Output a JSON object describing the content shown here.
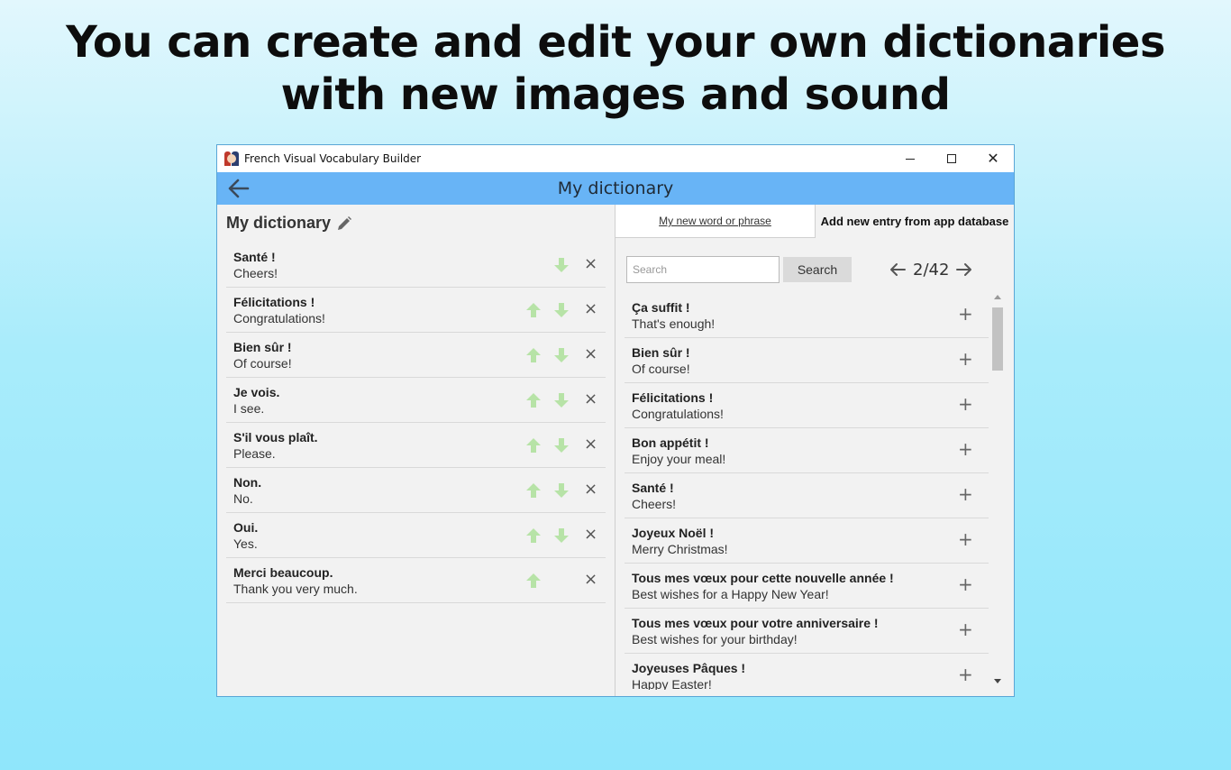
{
  "headline": {
    "line1": "You can create and edit your own dictionaries",
    "line2": "with new images and sound"
  },
  "window": {
    "title": "French Visual Vocabulary Builder",
    "header_title": "My dictionary"
  },
  "my_dictionary": {
    "heading": "My dictionary",
    "entries": [
      {
        "fr": "Santé !",
        "en": "Cheers!",
        "up": false,
        "down": true
      },
      {
        "fr": "Félicitations !",
        "en": "Congratulations!",
        "up": true,
        "down": true
      },
      {
        "fr": "Bien sûr !",
        "en": "Of course!",
        "up": true,
        "down": true
      },
      {
        "fr": "Je vois.",
        "en": "I see.",
        "up": true,
        "down": true
      },
      {
        "fr": "S'il vous plaît.",
        "en": "Please.",
        "up": true,
        "down": true
      },
      {
        "fr": "Non.",
        "en": "No.",
        "up": true,
        "down": true
      },
      {
        "fr": "Oui.",
        "en": "Yes.",
        "up": true,
        "down": true
      },
      {
        "fr": "Merci beaucoup.",
        "en": "Thank you very much.",
        "up": true,
        "down": false
      }
    ]
  },
  "tabs": {
    "new_word": "My new word or phrase",
    "add_from_db": "Add new entry from app database"
  },
  "search": {
    "placeholder": "Search",
    "button": "Search"
  },
  "pager": {
    "text": "2/42"
  },
  "database": {
    "entries": [
      {
        "fr": "Ça suffit !",
        "en": "That's enough!"
      },
      {
        "fr": "Bien sûr !",
        "en": "Of course!"
      },
      {
        "fr": "Félicitations !",
        "en": "Congratulations!"
      },
      {
        "fr": "Bon appétit !",
        "en": "Enjoy your meal!"
      },
      {
        "fr": "Santé !",
        "en": "Cheers!"
      },
      {
        "fr": "Joyeux Noël !",
        "en": "Merry Christmas!"
      },
      {
        "fr": "Tous mes vœux pour cette nouvelle année !",
        "en": "Best wishes for a Happy New Year!"
      },
      {
        "fr": "Tous mes vœux pour votre anniversaire !",
        "en": "Best wishes for your birthday!"
      },
      {
        "fr": "Joyeuses Pâques !",
        "en": "Happy Easter!"
      }
    ]
  },
  "icons": {
    "delete": "×",
    "add": "+"
  },
  "colors": {
    "header": "#68b4f6",
    "arrow_green": "#b7e3a7"
  }
}
